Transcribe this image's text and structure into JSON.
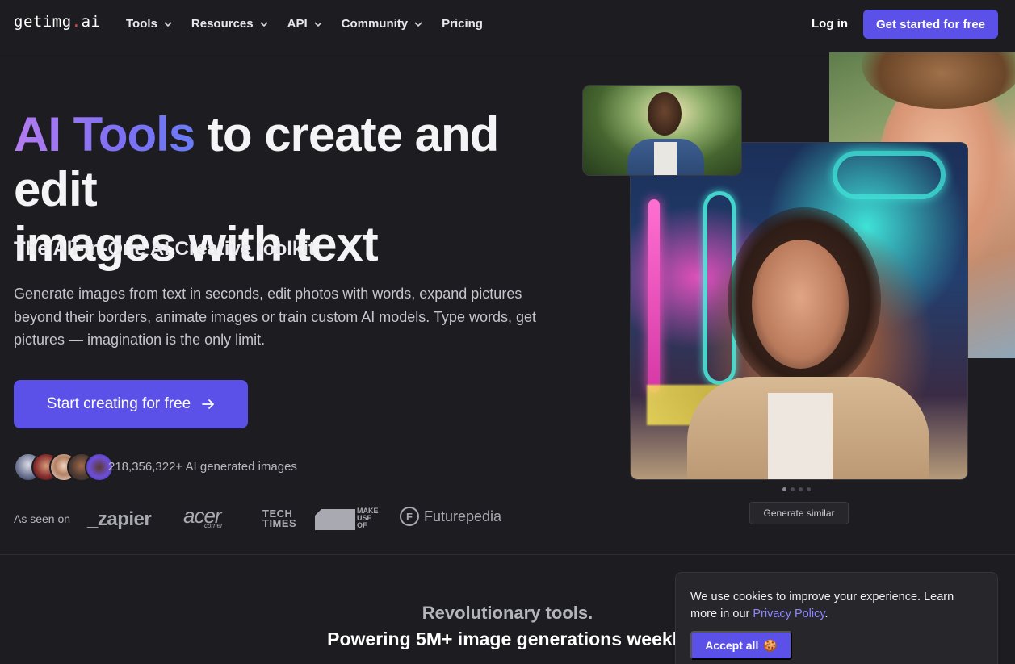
{
  "nav": {
    "logo": {
      "text_main": "getimg",
      "text_dot": ".",
      "text_tld": "ai"
    },
    "items": [
      {
        "label": "Tools",
        "has_dropdown": true
      },
      {
        "label": "Resources",
        "has_dropdown": true
      },
      {
        "label": "API",
        "has_dropdown": true
      },
      {
        "label": "Community",
        "has_dropdown": true
      },
      {
        "label": "Pricing",
        "has_dropdown": false
      }
    ],
    "login_label": "Log in",
    "cta_label": "Get started for free"
  },
  "hero": {
    "title_highlight": "AI Tools",
    "title_rest_line1": " to create and edit",
    "title_line2": "images with text",
    "subtitle": "The All-In-One AI Creative toolkit",
    "description": "Generate images from text in seconds, edit photos with words, expand pictures beyond their borders, animate images or train custom AI models. Type words, get pictures — imagination is the only limit.",
    "cta_label": "Start creating for free",
    "cta_icon": "arrow-right-icon",
    "generated_count": "218,356,322+ AI generated images",
    "seen_on_label": "As seen on",
    "brands": {
      "zapier": "_zapier",
      "acer": "acer",
      "acer_sub": "corner",
      "tech_line1": "TECH",
      "tech_line2": "TIMES",
      "makeuse_line1": "MAKE",
      "makeuse_line2": "USE",
      "makeuse_line3": "OF",
      "futurepedia": "Futurepedia",
      "futurepedia_letter": "F"
    }
  },
  "gallery": {
    "generate_similar_label": "Generate similar",
    "carousel_dots": 4,
    "active_dot": 0
  },
  "section": {
    "heading_line1": "Revolutionary tools.",
    "heading_line2": "Powering 5M+ image generations weekly"
  },
  "cookie": {
    "text_before": "We use cookies to improve your experience. Learn more in our ",
    "link_label": "Privacy Policy",
    "text_after": ".",
    "accept_label": "Accept all",
    "accept_icon": "🍪"
  },
  "colors": {
    "accent": "#5b51e8",
    "background": "#1d1d21",
    "link": "#8f86ff"
  }
}
